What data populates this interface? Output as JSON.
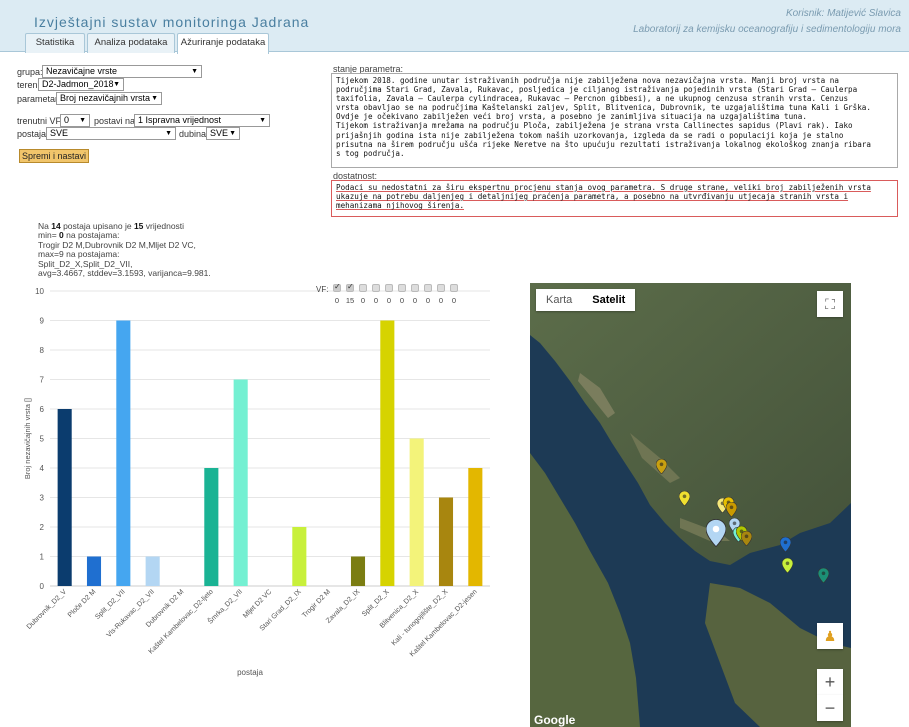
{
  "header": {
    "title": "Izvještajni sustav monitoringa Jadrana",
    "user": "Korisnik: Matijević Slavica",
    "lab": "Laboratorij za kemijsku oceanografiju i sedimentologiju mora",
    "tabs": [
      "Statistika",
      "Analiza podataka",
      "Ažuriranje podataka"
    ]
  },
  "form": {
    "grupa_label": "grupa:",
    "grupa_value": "Nezavičajne vrste",
    "teren_label": "teren:",
    "teren_value": "D2-Jadmon_2018",
    "parametar_label": "parametar:",
    "parametar_value": "Broj nezavičajnih vrsta",
    "vf_label": "trenutni VF :",
    "vf_value": "0",
    "postavi_label": "postavi na:",
    "postavi_value": "1 Ispravna vrijednost",
    "postaja_label": "postaja:",
    "postaja_value": "SVE",
    "dubina_label": "dubina:",
    "dubina_value": "SVE",
    "save_label": "Spremi i nastavi"
  },
  "stanje": {
    "label": "stanje parametra:",
    "lines": [
      "Tijekom 2018. godine unutar istraživanih područja nije zabilježena nova nezavičajna vrsta. Manji broj vrsta na",
      "područjima Stari Grad, Zavala, Rukavac, posljedica je ciljanog istraživanja pojedinih vrsta  (Stari Grad – Caulerpa",
      "taxifolia, Zavala – Caulerpa cylindracea, Rukavac – Percnon gibbesi), a ne ukupnog cenzusa stranih vrsta. Cenzus",
      "vrsta obavljao se na područjima Kaštelanski zaljev, Split, Blitvenica, Dubrovnik, te uzgajalištima tuna Kali i Grška.",
      "Ovdje je očekivano zabilježen veći broj vrsta, a posebno je zanimljiva situacija na uzgajalištima tuna.",
      "Tijekom istraživanja mrežama na području Ploča, zabilježena je strana vrsta Callinectes sapidus (Plavi rak). Iako",
      "prijašnjih godina ista nije zabilježena tokom naših uzorkovanja, izgleda da se radi o populaciji koja je stalno",
      "prisutna na širem području ušća rijeke Neretve na što upućuju rezultati istraživanja lokalnog ekološkog znanja ribara",
      "s tog područja."
    ]
  },
  "dostatnost": {
    "label": "dostatnost:",
    "lines": [
      "Podaci su nedostatni za širu ekspertnu procjenu stanja ovog parametra. S druge strane, veliki broj zabilježenih vrsta",
      "ukazuje na potrebu daljenjeg i detaljnijeg praćenja parametra, a posebno na utvrđivanju utjecaja stranih vrsta i",
      "mehanizama njihovog širenja."
    ]
  },
  "stats": {
    "line1_pre": "Na ",
    "line1_n": "14",
    "line1_mid": " postaja upisano je ",
    "line1_m": "15",
    "line1_post": " vrijednosti",
    "line2_pre": "min= ",
    "line2_val": "0",
    "line2_post": " na postajama:",
    "line3": "Trogir D2 M,Dubrovnik D2 M,Mljet D2 VC,",
    "line4": "max=9 na postajama:",
    "line5": "Split_D2_X,Split_D2_VII,",
    "line6": "avg=3.4667, stddev=3.1593, varijanca=9.981."
  },
  "vf": {
    "label": "VF:",
    "counts": [
      "0",
      "15",
      "0",
      "0",
      "0",
      "0",
      "0",
      "0",
      "0",
      "0"
    ]
  },
  "chart_data": {
    "type": "bar",
    "categories": [
      "Dubrovnik_D2_V",
      "Ploče D2 M",
      "Split_D2_VII",
      "Vis-Rukavac_D2_VII",
      "Dubrovnik D2 M",
      "Kaštel Kambelovac_D2-ljeto",
      "Šmrka_D2_VII",
      "Mljet D2 VC",
      "Stari Grad_D2_IX",
      "Trogir D2 M",
      "Zavala_D2_IX",
      "Split_D2_X",
      "Blitvenica_D2_X",
      "Kali - tunogojilište_D2_X",
      "Kaštel Kambelovac_D2-jesen"
    ],
    "values": [
      6,
      1,
      9,
      1,
      0,
      4,
      7,
      0,
      2,
      0,
      1,
      9,
      5,
      3,
      4
    ],
    "colors": [
      "#0b3c6e",
      "#1f6fd0",
      "#45a6f0",
      "#b3d6f3",
      "#1c8f76",
      "#1ab394",
      "#74f0d2",
      "#8fe0c4",
      "#c8f03b",
      "#9bc52a",
      "#7b7d12",
      "#d6d300",
      "#f3f37a",
      "#a8860f",
      "#e3b700"
    ],
    "title": "",
    "xlabel": "postaja",
    "ylabel": "Broj nezavičajnih vrsta []",
    "ylim": [
      0,
      10
    ],
    "yticks": [
      "0",
      "1",
      "2",
      "3",
      "4",
      "5",
      "6",
      "7",
      "8",
      "9",
      "10"
    ]
  },
  "map": {
    "tab_karta": "Karta",
    "tab_satelit": "Satelit",
    "fullscreen_icon": "fullscreen-icon",
    "zoom_in": "+",
    "zoom_out": "−",
    "attribution": "Google",
    "pins": [
      {
        "color": "#c8a010"
      },
      {
        "color": "#f0e030"
      },
      {
        "color": "#f5e87a"
      },
      {
        "color": "#e8c000"
      },
      {
        "color": "#c89a00"
      },
      {
        "color": "#b3d6f3"
      },
      {
        "color": "#74f0d2"
      },
      {
        "color": "#b0c800"
      },
      {
        "color": "#a8860f"
      },
      {
        "color": "#1f6fd0"
      },
      {
        "color": "#c8f03b"
      },
      {
        "color": "#1c8f76"
      }
    ]
  }
}
